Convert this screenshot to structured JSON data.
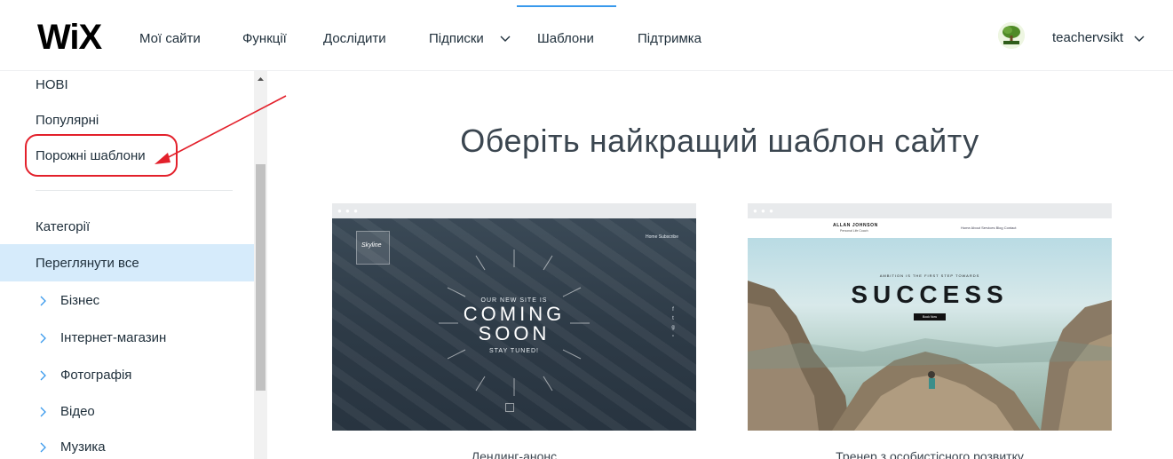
{
  "header": {
    "logo": "WiX",
    "nav": [
      {
        "label": "Мої сайти"
      },
      {
        "label": "Функції"
      },
      {
        "label": "Дослідити"
      },
      {
        "label": "Підписки"
      },
      {
        "label": "Шаблони"
      },
      {
        "label": "Підтримка"
      }
    ],
    "active_tab": "Шаблони",
    "user": {
      "name": "teachervsikt"
    }
  },
  "sidebar": {
    "top_items": [
      {
        "label": "НОВІ"
      },
      {
        "label": "Популярні"
      },
      {
        "label": "Порожні шаблони"
      }
    ],
    "categories_title": "Категорії",
    "selected": "Переглянути все",
    "categories": [
      {
        "label": "Бізнес"
      },
      {
        "label": "Інтернет-магазин"
      },
      {
        "label": "Фотографія"
      },
      {
        "label": "Відео"
      },
      {
        "label": "Музика"
      }
    ]
  },
  "main": {
    "title": "Оберіть найкращий шаблон сайту",
    "cards": [
      {
        "caption": "Лендинг-анонс",
        "preview": {
          "logo": "Skyline",
          "nav": "Home   Subscribe",
          "small_top": "OUR NEW SITE IS",
          "line1": "COMING",
          "line2": "SOON",
          "small_bottom": "STAY TUNED!"
        }
      },
      {
        "caption": "Тренер з особистісного розвитку",
        "preview": {
          "name": "ALLAN JOHNSON",
          "subtitle": "Personal Life Coach",
          "menu": "Home   About   Services   Blog   Contact",
          "small": "AMBITION IS THE FIRST STEP TOWARDS",
          "big": "SUCCESS",
          "button": "Book Now"
        }
      }
    ]
  },
  "colors": {
    "accent": "#3899ec",
    "selected_bg": "#d6ebfb",
    "annotation": "#e3202b"
  }
}
